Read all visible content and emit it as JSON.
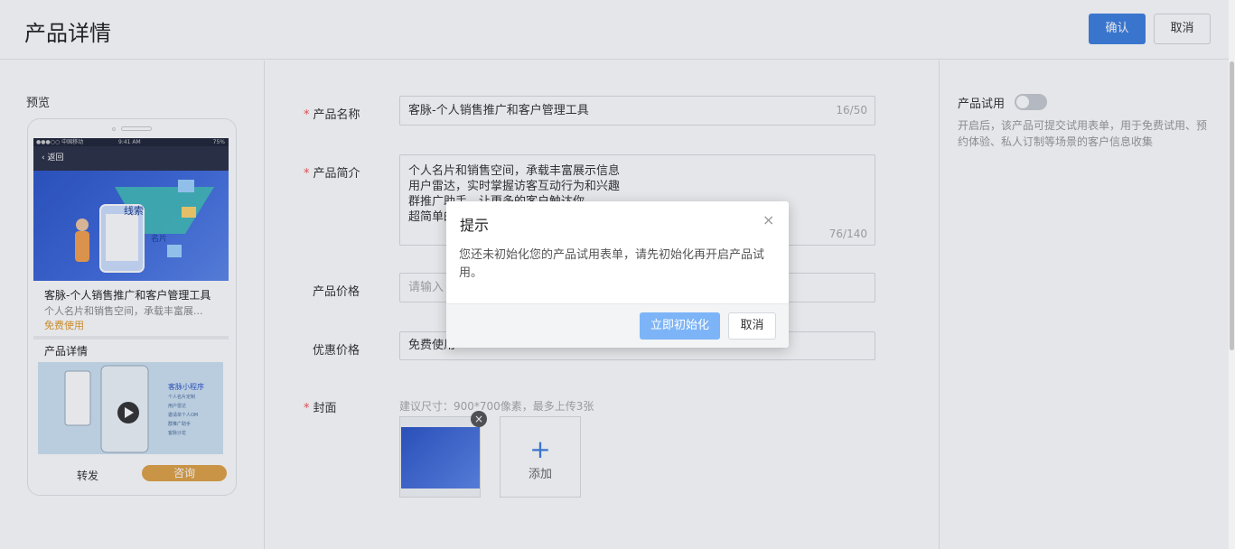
{
  "header": {
    "title": "产品详情",
    "confirm_label": "确认",
    "cancel_label": "取消"
  },
  "preview": {
    "label": "预览",
    "status_carrier": "●●●○○ 中国移动",
    "status_time": "9:41 AM",
    "status_battery": "75%",
    "back_label": "返回",
    "banner_text_1": "线索",
    "banner_text_2": "名片",
    "card_title": "客脉-个人销售推广和客户管理工具",
    "card_sub": "个人名片和销售空间，承载丰富展...",
    "card_free": "免费使用",
    "detail_title": "产品详情",
    "detail_img_heading": "客脉小程序",
    "detail_img_lines": [
      "个人名片定制",
      "用户雷达",
      "邀请单个人OM",
      "群推广助手",
      "客脉沙龙"
    ],
    "share_label": "转发",
    "consult_label": "咨询"
  },
  "form": {
    "name_label": "产品名称",
    "name_value": "客脉-个人销售推广和客户管理工具",
    "name_counter": "16/50",
    "intro_label": "产品简介",
    "intro_lines": [
      "个人名片和销售空间，承载丰富展示信息",
      "用户雷达，实时掌握访客互动行为和兴趣",
      "群推广助手，让更多的客户触达你",
      "超简单的"
    ],
    "intro_counter": "76/140",
    "price_label": "产品价格",
    "price_placeholder": "请输入",
    "discount_label": "优惠价格",
    "discount_value": "免费使用",
    "cover_label": "封面",
    "cover_hint": "建议尺寸：900*700像素，最多上传3张",
    "add_label": "添加"
  },
  "trial": {
    "label": "产品试用",
    "enabled": false,
    "description": "开启后，该产品可提交试用表单，用于免费试用、预约体验、私人订制等场景的客户信息收集"
  },
  "dialog": {
    "title": "提示",
    "close_glyph": "×",
    "message": "您还未初始化您的产品试用表单，请先初始化再开启产品试用。",
    "init_label": "立即初始化",
    "cancel_label": "取消"
  },
  "colors": {
    "primary": "#3d7fe0",
    "primary_light": "#7cb4f7",
    "required": "#e55555",
    "accent_orange": "#e0a245"
  }
}
